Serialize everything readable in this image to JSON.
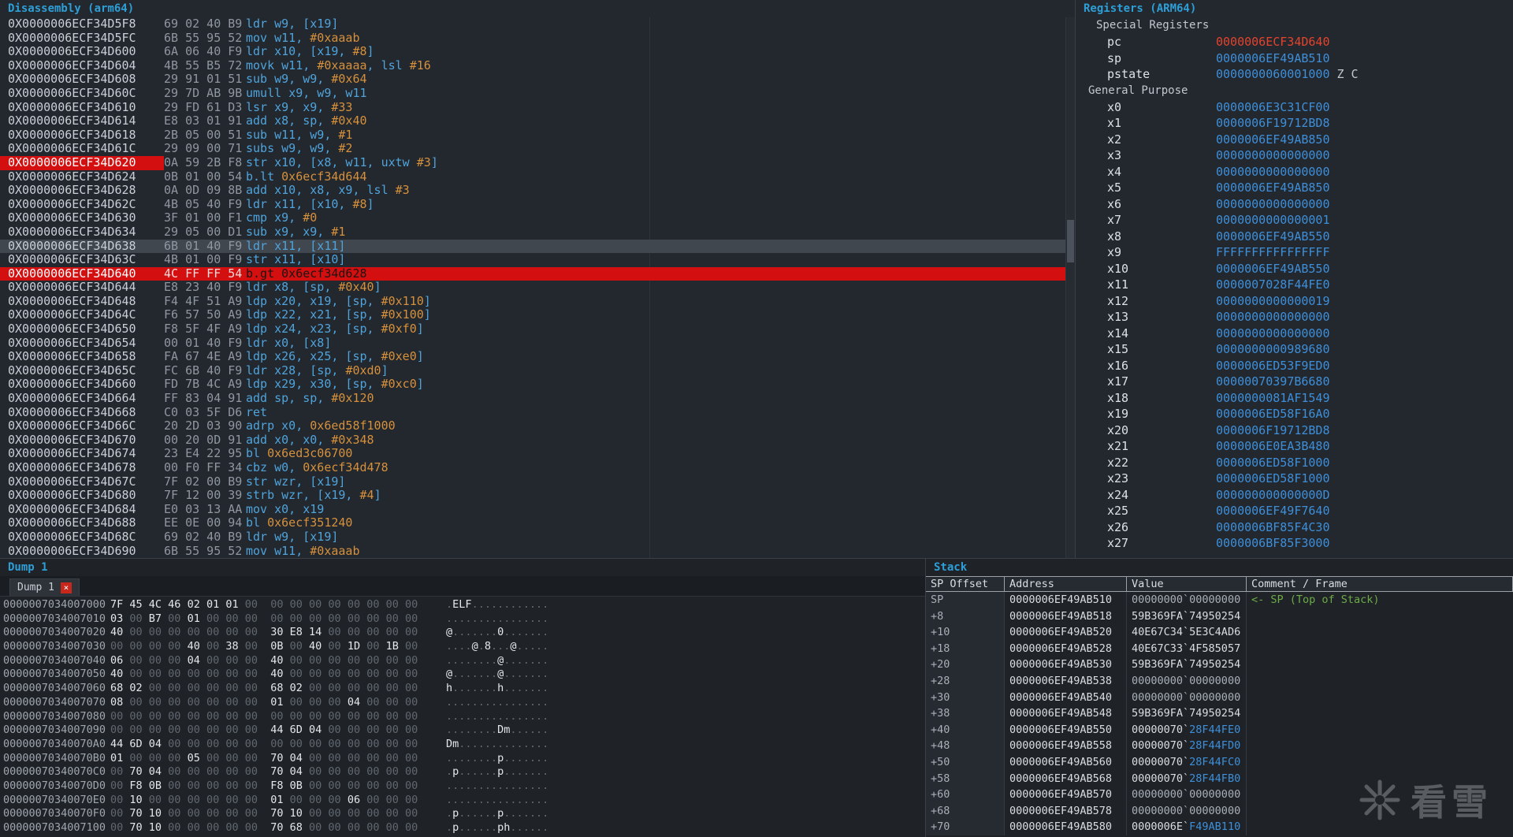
{
  "colors": {
    "accent_blue": "#2E9FD6",
    "value_blue": "#3E8FD9",
    "highlight_red": "#D40F0F",
    "comment_green": "#6CAB46",
    "number_orange": "#D6913C"
  },
  "disassembly": {
    "title": "Disassembly (arm64)",
    "rows": [
      {
        "addr": "0X0000006ECF34D5F8",
        "bytes": "69 02 40 B9",
        "mn": "ldr",
        "ops": "w9, [x19]"
      },
      {
        "addr": "0X0000006ECF34D5FC",
        "bytes": "6B 55 95 52",
        "mn": "mov",
        "ops": "w11, #0xaaab"
      },
      {
        "addr": "0X0000006ECF34D600",
        "bytes": "6A 06 40 F9",
        "mn": "ldr",
        "ops": "x10, [x19, #8]"
      },
      {
        "addr": "0X0000006ECF34D604",
        "bytes": "4B 55 B5 72",
        "mn": "movk",
        "ops": "w11, #0xaaaa, lsl #16"
      },
      {
        "addr": "0X0000006ECF34D608",
        "bytes": "29 91 01 51",
        "mn": "sub",
        "ops": "w9, w9, #0x64"
      },
      {
        "addr": "0X0000006ECF34D60C",
        "bytes": "29 7D AB 9B",
        "mn": "umull",
        "ops": "x9, w9, w11"
      },
      {
        "addr": "0X0000006ECF34D610",
        "bytes": "29 FD 61 D3",
        "mn": "lsr",
        "ops": "x9, x9, #33"
      },
      {
        "addr": "0X0000006ECF34D614",
        "bytes": "E8 03 01 91",
        "mn": "add",
        "ops": "x8, sp, #0x40"
      },
      {
        "addr": "0X0000006ECF34D618",
        "bytes": "2B 05 00 51",
        "mn": "sub",
        "ops": "w11, w9, #1"
      },
      {
        "addr": "0X0000006ECF34D61C",
        "bytes": "29 09 00 71",
        "mn": "subs",
        "ops": "w9, w9, #2"
      },
      {
        "addr": "0X0000006ECF34D620",
        "bytes": "0A 59 2B F8",
        "mn": "str",
        "ops": "x10, [x8, w11, uxtw #3]",
        "hl": "bp"
      },
      {
        "addr": "0X0000006ECF34D624",
        "bytes": "0B 01 00 54",
        "mn": "b.lt",
        "ops": "0x6ecf34d644"
      },
      {
        "addr": "0X0000006ECF34D628",
        "bytes": "0A 0D 09 8B",
        "mn": "add",
        "ops": "x10, x8, x9, lsl #3"
      },
      {
        "addr": "0X0000006ECF34D62C",
        "bytes": "4B 05 40 F9",
        "mn": "ldr",
        "ops": "x11, [x10, #8]"
      },
      {
        "addr": "0X0000006ECF34D630",
        "bytes": "3F 01 00 F1",
        "mn": "cmp",
        "ops": "x9, #0"
      },
      {
        "addr": "0X0000006ECF34D634",
        "bytes": "29 05 00 D1",
        "mn": "sub",
        "ops": "x9, x9, #1"
      },
      {
        "addr": "0X0000006ECF34D638",
        "bytes": "6B 01 40 F9",
        "mn": "ldr",
        "ops": "x11, [x11]",
        "hl": "sel"
      },
      {
        "addr": "0X0000006ECF34D63C",
        "bytes": "4B 01 00 F9",
        "mn": "str",
        "ops": "x11, [x10]"
      },
      {
        "addr": "0X0000006ECF34D640",
        "bytes": "4C FF FF 54",
        "mn": "b.gt",
        "ops": "0x6ecf34d628",
        "hl": "cur"
      },
      {
        "addr": "0X0000006ECF34D644",
        "bytes": "E8 23 40 F9",
        "mn": "ldr",
        "ops": "x8, [sp, #0x40]"
      },
      {
        "addr": "0X0000006ECF34D648",
        "bytes": "F4 4F 51 A9",
        "mn": "ldp",
        "ops": "x20, x19, [sp, #0x110]"
      },
      {
        "addr": "0X0000006ECF34D64C",
        "bytes": "F6 57 50 A9",
        "mn": "ldp",
        "ops": "x22, x21, [sp, #0x100]"
      },
      {
        "addr": "0X0000006ECF34D650",
        "bytes": "F8 5F 4F A9",
        "mn": "ldp",
        "ops": "x24, x23, [sp, #0xf0]"
      },
      {
        "addr": "0X0000006ECF34D654",
        "bytes": "00 01 40 F9",
        "mn": "ldr",
        "ops": "x0, [x8]"
      },
      {
        "addr": "0X0000006ECF34D658",
        "bytes": "FA 67 4E A9",
        "mn": "ldp",
        "ops": "x26, x25, [sp, #0xe0]"
      },
      {
        "addr": "0X0000006ECF34D65C",
        "bytes": "FC 6B 40 F9",
        "mn": "ldr",
        "ops": "x28, [sp, #0xd0]"
      },
      {
        "addr": "0X0000006ECF34D660",
        "bytes": "FD 7B 4C A9",
        "mn": "ldp",
        "ops": "x29, x30, [sp, #0xc0]"
      },
      {
        "addr": "0X0000006ECF34D664",
        "bytes": "FF 83 04 91",
        "mn": "add",
        "ops": "sp, sp, #0x120"
      },
      {
        "addr": "0X0000006ECF34D668",
        "bytes": "C0 03 5F D6",
        "mn": "ret",
        "ops": ""
      },
      {
        "addr": "0X0000006ECF34D66C",
        "bytes": "20 2D 03 90",
        "mn": "adrp",
        "ops": "x0, 0x6ed58f1000"
      },
      {
        "addr": "0X0000006ECF34D670",
        "bytes": "00 20 0D 91",
        "mn": "add",
        "ops": "x0, x0, #0x348"
      },
      {
        "addr": "0X0000006ECF34D674",
        "bytes": "23 E4 22 95",
        "mn": "bl",
        "ops": "0x6ed3c06700"
      },
      {
        "addr": "0X0000006ECF34D678",
        "bytes": "00 F0 FF 34",
        "mn": "cbz",
        "ops": "w0, 0x6ecf34d478"
      },
      {
        "addr": "0X0000006ECF34D67C",
        "bytes": "7F 02 00 B9",
        "mn": "str",
        "ops": "wzr, [x19]"
      },
      {
        "addr": "0X0000006ECF34D680",
        "bytes": "7F 12 00 39",
        "mn": "strb",
        "ops": "wzr, [x19, #4]"
      },
      {
        "addr": "0X0000006ECF34D684",
        "bytes": "E0 03 13 AA",
        "mn": "mov",
        "ops": "x0, x19"
      },
      {
        "addr": "0X0000006ECF34D688",
        "bytes": "EE 0E 00 94",
        "mn": "bl",
        "ops": "0x6ecf351240"
      },
      {
        "addr": "0X0000006ECF34D68C",
        "bytes": "69 02 40 B9",
        "mn": "ldr",
        "ops": "w9, [x19]"
      },
      {
        "addr": "0X0000006ECF34D690",
        "bytes": "6B 55 95 52",
        "mn": "mov",
        "ops": "w11, #0xaaab"
      }
    ]
  },
  "registers": {
    "title": "Registers (ARM64)",
    "special_label": "Special Registers",
    "general_label": "General Purpose",
    "special": [
      {
        "name": "pc",
        "value": "0000006ECF34D640",
        "color": "red"
      },
      {
        "name": "sp",
        "value": "0000006EF49AB510"
      },
      {
        "name": "pstate",
        "value": "0000000060001000",
        "flags": "Z C"
      }
    ],
    "general": [
      {
        "name": "x0",
        "value": "0000006E3C31CF00"
      },
      {
        "name": "x1",
        "value": "0000006F19712BD8"
      },
      {
        "name": "x2",
        "value": "0000006EF49AB850"
      },
      {
        "name": "x3",
        "value": "0000000000000000"
      },
      {
        "name": "x4",
        "value": "0000000000000000"
      },
      {
        "name": "x5",
        "value": "0000006EF49AB850"
      },
      {
        "name": "x6",
        "value": "0000000000000000"
      },
      {
        "name": "x7",
        "value": "0000000000000001"
      },
      {
        "name": "x8",
        "value": "0000006EF49AB550"
      },
      {
        "name": "x9",
        "value": "FFFFFFFFFFFFFFFF"
      },
      {
        "name": "x10",
        "value": "0000006EF49AB550"
      },
      {
        "name": "x11",
        "value": "0000007028F44FE0"
      },
      {
        "name": "x12",
        "value": "0000000000000019"
      },
      {
        "name": "x13",
        "value": "0000000000000000"
      },
      {
        "name": "x14",
        "value": "0000000000000000"
      },
      {
        "name": "x15",
        "value": "0000000000989680"
      },
      {
        "name": "x16",
        "value": "0000006ED53F9ED0"
      },
      {
        "name": "x17",
        "value": "00000070397B6680"
      },
      {
        "name": "x18",
        "value": "0000000081AF1549"
      },
      {
        "name": "x19",
        "value": "0000006ED58F16A0"
      },
      {
        "name": "x20",
        "value": "0000006F19712BD8"
      },
      {
        "name": "x21",
        "value": "0000006E0EA3B480"
      },
      {
        "name": "x22",
        "value": "0000006ED58F1000"
      },
      {
        "name": "x23",
        "value": "0000006ED58F1000"
      },
      {
        "name": "x24",
        "value": "000000000000000D"
      },
      {
        "name": "x25",
        "value": "0000006EF49F7640"
      },
      {
        "name": "x26",
        "value": "0000006BF85F4C30"
      },
      {
        "name": "x27",
        "value": "0000006BF85F3000"
      }
    ]
  },
  "dump": {
    "title": "Dump 1",
    "tab_label": "Dump 1",
    "close_label": "×",
    "rows": [
      {
        "addr": "0000007034007000",
        "bytes": [
          "7F",
          "45",
          "4C",
          "46",
          "02",
          "01",
          "01",
          "00",
          "00",
          "00",
          "00",
          "00",
          "00",
          "00",
          "00",
          "00"
        ],
        "ascii": ".ELF............"
      },
      {
        "addr": "0000007034007010",
        "bytes": [
          "03",
          "00",
          "B7",
          "00",
          "01",
          "00",
          "00",
          "00",
          "00",
          "00",
          "00",
          "00",
          "00",
          "00",
          "00",
          "00"
        ],
        "ascii": "................"
      },
      {
        "addr": "0000007034007020",
        "bytes": [
          "40",
          "00",
          "00",
          "00",
          "00",
          "00",
          "00",
          "00",
          "30",
          "E8",
          "14",
          "00",
          "00",
          "00",
          "00",
          "00"
        ],
        "ascii": "@.......0......."
      },
      {
        "addr": "0000007034007030",
        "bytes": [
          "00",
          "00",
          "00",
          "00",
          "40",
          "00",
          "38",
          "00",
          "0B",
          "00",
          "40",
          "00",
          "1D",
          "00",
          "1B",
          "00"
        ],
        "ascii": "....@.8...@....."
      },
      {
        "addr": "0000007034007040",
        "bytes": [
          "06",
          "00",
          "00",
          "00",
          "04",
          "00",
          "00",
          "00",
          "40",
          "00",
          "00",
          "00",
          "00",
          "00",
          "00",
          "00"
        ],
        "ascii": "........@......."
      },
      {
        "addr": "0000007034007050",
        "bytes": [
          "40",
          "00",
          "00",
          "00",
          "00",
          "00",
          "00",
          "00",
          "40",
          "00",
          "00",
          "00",
          "00",
          "00",
          "00",
          "00"
        ],
        "ascii": "@.......@......."
      },
      {
        "addr": "0000007034007060",
        "bytes": [
          "68",
          "02",
          "00",
          "00",
          "00",
          "00",
          "00",
          "00",
          "68",
          "02",
          "00",
          "00",
          "00",
          "00",
          "00",
          "00"
        ],
        "ascii": "h.......h......."
      },
      {
        "addr": "0000007034007070",
        "bytes": [
          "08",
          "00",
          "00",
          "00",
          "00",
          "00",
          "00",
          "00",
          "01",
          "00",
          "00",
          "00",
          "04",
          "00",
          "00",
          "00"
        ],
        "ascii": "................"
      },
      {
        "addr": "0000007034007080",
        "bytes": [
          "00",
          "00",
          "00",
          "00",
          "00",
          "00",
          "00",
          "00",
          "00",
          "00",
          "00",
          "00",
          "00",
          "00",
          "00",
          "00"
        ],
        "ascii": "................"
      },
      {
        "addr": "0000007034007090",
        "bytes": [
          "00",
          "00",
          "00",
          "00",
          "00",
          "00",
          "00",
          "00",
          "44",
          "6D",
          "04",
          "00",
          "00",
          "00",
          "00",
          "00"
        ],
        "ascii": "........Dm......"
      },
      {
        "addr": "00000070340070A0",
        "bytes": [
          "44",
          "6D",
          "04",
          "00",
          "00",
          "00",
          "00",
          "00",
          "00",
          "00",
          "00",
          "00",
          "00",
          "00",
          "00",
          "00"
        ],
        "ascii": "Dm.............."
      },
      {
        "addr": "00000070340070B0",
        "bytes": [
          "01",
          "00",
          "00",
          "00",
          "05",
          "00",
          "00",
          "00",
          "70",
          "04",
          "00",
          "00",
          "00",
          "00",
          "00",
          "00"
        ],
        "ascii": "........p......."
      },
      {
        "addr": "00000070340070C0",
        "bytes": [
          "00",
          "70",
          "04",
          "00",
          "00",
          "00",
          "00",
          "00",
          "70",
          "04",
          "00",
          "00",
          "00",
          "00",
          "00",
          "00"
        ],
        "ascii": ".p......p......."
      },
      {
        "addr": "00000070340070D0",
        "bytes": [
          "00",
          "F8",
          "0B",
          "00",
          "00",
          "00",
          "00",
          "00",
          "F8",
          "0B",
          "00",
          "00",
          "00",
          "00",
          "00",
          "00"
        ],
        "ascii": "................"
      },
      {
        "addr": "00000070340070E0",
        "bytes": [
          "00",
          "10",
          "00",
          "00",
          "00",
          "00",
          "00",
          "00",
          "01",
          "00",
          "00",
          "00",
          "06",
          "00",
          "00",
          "00"
        ],
        "ascii": "................"
      },
      {
        "addr": "00000070340070F0",
        "bytes": [
          "00",
          "70",
          "10",
          "00",
          "00",
          "00",
          "00",
          "00",
          "70",
          "10",
          "00",
          "00",
          "00",
          "00",
          "00",
          "00"
        ],
        "ascii": ".p......p......."
      },
      {
        "addr": "0000007034007100",
        "bytes": [
          "00",
          "70",
          "10",
          "00",
          "00",
          "00",
          "00",
          "00",
          "70",
          "68",
          "00",
          "00",
          "00",
          "00",
          "00",
          "00"
        ],
        "ascii": ".p......ph......"
      }
    ]
  },
  "stack": {
    "title": "Stack",
    "columns": [
      "SP Offset",
      "Address",
      "Value",
      "Comment / Frame"
    ],
    "rows": [
      {
        "off": "SP",
        "addr": "0000006EF49AB510",
        "hi": "00000000",
        "lo": "00000000",
        "dim": true,
        "comment": "<- SP (Top of Stack)"
      },
      {
        "off": "+8",
        "addr": "0000006EF49AB518",
        "hi": "59B369FA",
        "lo": "74950254"
      },
      {
        "off": "+10",
        "addr": "0000006EF49AB520",
        "hi": "40E67C34",
        "lo": "5E3C4AD6"
      },
      {
        "off": "+18",
        "addr": "0000006EF49AB528",
        "hi": "40E67C33",
        "lo": "4F585057"
      },
      {
        "off": "+20",
        "addr": "0000006EF49AB530",
        "hi": "59B369FA",
        "lo": "74950254"
      },
      {
        "off": "+28",
        "addr": "0000006EF49AB538",
        "hi": "00000000",
        "lo": "00000000",
        "dim": true
      },
      {
        "off": "+30",
        "addr": "0000006EF49AB540",
        "hi": "00000000",
        "lo": "00000000",
        "dim": true
      },
      {
        "off": "+38",
        "addr": "0000006EF49AB548",
        "hi": "59B369FA",
        "lo": "74950254"
      },
      {
        "off": "+40",
        "addr": "0000006EF49AB550",
        "hi": "00000070",
        "lo": "28F44FE0",
        "lo_blue": true
      },
      {
        "off": "+48",
        "addr": "0000006EF49AB558",
        "hi": "00000070",
        "lo": "28F44FD0",
        "lo_blue": true
      },
      {
        "off": "+50",
        "addr": "0000006EF49AB560",
        "hi": "00000070",
        "lo": "28F44FC0",
        "lo_blue": true
      },
      {
        "off": "+58",
        "addr": "0000006EF49AB568",
        "hi": "00000070",
        "lo": "28F44FB0",
        "lo_blue": true
      },
      {
        "off": "+60",
        "addr": "0000006EF49AB570",
        "hi": "00000000",
        "lo": "00000000",
        "dim": true
      },
      {
        "off": "+68",
        "addr": "0000006EF49AB578",
        "hi": "00000000",
        "lo": "00000000",
        "dim": true
      },
      {
        "off": "+70",
        "addr": "0000006EF49AB580",
        "hi": "0000006E",
        "lo": "F49AB110",
        "lo_blue": true
      }
    ]
  },
  "watermark": {
    "text": "看雪"
  }
}
